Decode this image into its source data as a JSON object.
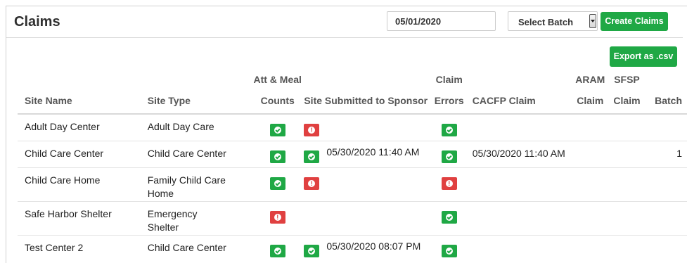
{
  "header": {
    "title": "Claims",
    "date_value": "05/01/2020",
    "batch_select_label": "Select Batch",
    "create_button": "Create Claims",
    "export_button": "Export as .csv"
  },
  "table": {
    "headers_top": {
      "att_meal": "Att & Meal",
      "claim_errors": "Claim",
      "aram": "ARAM",
      "sfsp": "SFSP"
    },
    "headers": {
      "site_name": "Site Name",
      "site_type": "Site Type",
      "att_meal": "Counts",
      "site_submitted": "Site Submitted to Sponsor",
      "claim_errors": "Errors",
      "cacfp": "CACFP Claim",
      "aram": "Claim",
      "sfsp": "Claim",
      "batch": "Batch"
    },
    "rows": [
      {
        "site_name": "Adult Day Center",
        "site_type": "Adult Day Care",
        "att_meal_status": "ok",
        "submitted_status": "error",
        "submitted_time": "",
        "errors_status": "ok",
        "cacfp_claim": "",
        "aram_claim": "",
        "sfsp_claim": "",
        "batch": ""
      },
      {
        "site_name": "Child Care Center",
        "site_type": "Child Care Center",
        "att_meal_status": "ok",
        "submitted_status": "ok",
        "submitted_time": "05/30/2020 11:40 AM",
        "errors_status": "ok",
        "cacfp_claim": "05/30/2020 11:40 AM",
        "aram_claim": "",
        "sfsp_claim": "",
        "batch": "1"
      },
      {
        "site_name": "Child Care Home",
        "site_type": "Family Child Care Home",
        "att_meal_status": "ok",
        "submitted_status": "error",
        "submitted_time": "",
        "errors_status": "error",
        "cacfp_claim": "",
        "aram_claim": "",
        "sfsp_claim": "",
        "batch": ""
      },
      {
        "site_name": "Safe Harbor Shelter",
        "site_type": "Emergency Shelter",
        "att_meal_status": "error",
        "submitted_status": "",
        "submitted_time": "",
        "errors_status": "ok",
        "cacfp_claim": "",
        "aram_claim": "",
        "sfsp_claim": "",
        "batch": ""
      },
      {
        "site_name": "Test Center 2",
        "site_type": "Child Care Center",
        "att_meal_status": "ok",
        "submitted_status": "ok",
        "submitted_time": "05/30/2020 08:07 PM",
        "errors_status": "ok",
        "cacfp_claim": "",
        "aram_claim": "",
        "sfsp_claim": "",
        "batch": ""
      }
    ]
  },
  "colors": {
    "success": "#1fa845",
    "danger": "#e04040",
    "header_text": "#555555"
  },
  "icons": {
    "ok": "check-circle-icon",
    "error": "exclamation-circle-icon"
  }
}
